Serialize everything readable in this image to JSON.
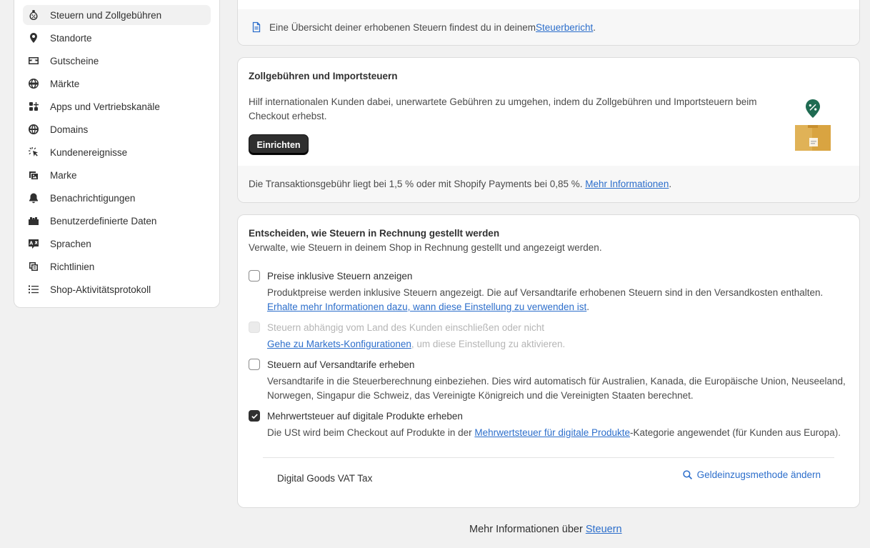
{
  "sidebar": {
    "items": [
      {
        "label": "Steuern und Zollgebühren",
        "icon": "tax-icon",
        "active": true
      },
      {
        "label": "Standorte",
        "icon": "location-icon"
      },
      {
        "label": "Gutscheine",
        "icon": "gift-card-icon"
      },
      {
        "label": "Märkte",
        "icon": "globe-market-icon"
      },
      {
        "label": "Apps und Vertriebskanäle",
        "icon": "apps-icon"
      },
      {
        "label": "Domains",
        "icon": "globe-icon"
      },
      {
        "label": "Kundenereignisse",
        "icon": "cursor-click-icon"
      },
      {
        "label": "Marke",
        "icon": "brand-image-icon"
      },
      {
        "label": "Benachrichtigungen",
        "icon": "bell-icon"
      },
      {
        "label": "Benutzerdefinierte Daten",
        "icon": "metafields-icon"
      },
      {
        "label": "Sprachen",
        "icon": "language-icon"
      },
      {
        "label": "Richtlinien",
        "icon": "policy-icon"
      },
      {
        "label": "Shop-Aktivitätsprotokoll",
        "icon": "list-icon"
      }
    ]
  },
  "report_card": {
    "text_before": "Eine Übersicht deiner erhobenen Steuern findest du in deinem ",
    "link": "Steuerbericht",
    "text_after": "."
  },
  "duties_card": {
    "title": "Zollgebühren und Importsteuern",
    "description": "Hilf internationalen Kunden dabei, unerwartete Gebühren zu umgehen, indem du Zollgebühren und Importsteuern beim Checkout erhebst.",
    "button": "Einrichten",
    "fee_text": "Die Transaktionsgebühr liegt bei 1,5 % oder mit Shopify Payments bei 0,85 %. ",
    "fee_link": "Mehr Informationen",
    "fee_after": "."
  },
  "tax_card": {
    "title": "Entscheiden, wie Steuern in Rechnung gestellt werden",
    "subtitle": "Verwalte, wie Steuern in deinem Shop in Rechnung gestellt und angezeigt werden.",
    "opt1_label": "Preise inklusive Steuern anzeigen",
    "opt1_help": "Produktpreise werden inklusive Steuern angezeigt. Die auf Versandtarife erhobenen Steuern sind in den Versandkosten enthalten.",
    "opt1_link": "Erhalte mehr Informationen dazu, wann diese Einstellung zu verwenden ist",
    "opt1_link_after": ".",
    "opt2_label": "Steuern abhängig vom Land des Kunden einschließen oder nicht",
    "opt2_link": "Gehe zu Markets-Konfigurationen",
    "opt2_after": ", um diese Einstellung zu aktivieren.",
    "opt3_label": "Steuern auf Versandtarife erheben",
    "opt3_help": "Versandtarife in die Steuerberechnung einbeziehen. Dies wird automatisch für Australien, Kanada, die Europäische Union, Neuseeland, Norwegen, Singapur die Schweiz, das Vereinigte Königreich und die Vereinigten Staaten berechnet.",
    "opt4_label": "Mehrwertsteuer auf digitale Produkte erheben",
    "opt4_help_before": "Die USt wird beim Checkout auf Produkte in der ",
    "opt4_link": "Mehrwertsteuer für digitale Produkte",
    "opt4_help_after": "-Kategorie angewendet (für Kunden aus Europa).",
    "vat_name": "Digital Goods VAT Tax",
    "vat_action": "Geldeinzugsmethode ändern"
  },
  "footer": {
    "text": "Mehr Informationen über ",
    "link": "Steuern"
  },
  "colors": {
    "link": "#2c6ecb",
    "button_dark": "#2f2f2f",
    "box": "#d9a441",
    "badge": "#1f6b52"
  }
}
